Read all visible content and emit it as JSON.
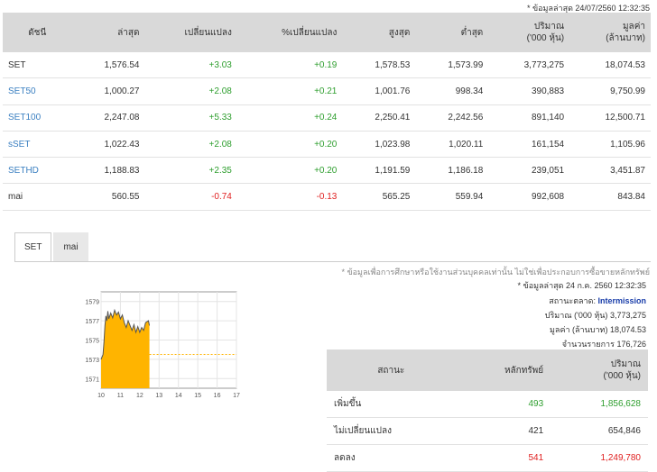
{
  "top_note": "* ข้อมูลล่าสุด 24/07/2560 12:32:35",
  "index_table": {
    "headers": [
      "ดัชนี",
      "ล่าสุด",
      "เปลี่ยนแปลง",
      "%เปลี่ยนแปลง",
      "สูงสุด",
      "ต่ำสุด",
      "ปริมาณ\n('000 หุ้น)",
      "มูลค่า\n(ล้านบาท)"
    ],
    "rows": [
      {
        "name": "SET",
        "last": "1,576.54",
        "change": "+3.03",
        "pct": "+0.19",
        "high": "1,578.53",
        "low": "1,573.99",
        "volume": "3,773,275",
        "value": "18,074.53",
        "link": false,
        "dir": "up"
      },
      {
        "name": "SET50",
        "last": "1,000.27",
        "change": "+2.08",
        "pct": "+0.21",
        "high": "1,001.76",
        "low": "998.34",
        "volume": "390,883",
        "value": "9,750.99",
        "link": true,
        "dir": "up"
      },
      {
        "name": "SET100",
        "last": "2,247.08",
        "change": "+5.33",
        "pct": "+0.24",
        "high": "2,250.41",
        "low": "2,242.56",
        "volume": "891,140",
        "value": "12,500.71",
        "link": true,
        "dir": "up"
      },
      {
        "name": "sSET",
        "last": "1,022.43",
        "change": "+2.08",
        "pct": "+0.20",
        "high": "1,023.98",
        "low": "1,020.11",
        "volume": "161,154",
        "value": "1,105.96",
        "link": true,
        "dir": "up"
      },
      {
        "name": "SETHD",
        "last": "1,188.83",
        "change": "+2.35",
        "pct": "+0.20",
        "high": "1,191.59",
        "low": "1,186.18",
        "volume": "239,051",
        "value": "3,451.87",
        "link": true,
        "dir": "up"
      },
      {
        "name": "mai",
        "last": "560.55",
        "change": "-0.74",
        "pct": "-0.13",
        "high": "565.25",
        "low": "559.94",
        "volume": "992,608",
        "value": "843.84",
        "link": false,
        "dir": "down"
      }
    ]
  },
  "tabs": [
    {
      "label": "SET",
      "active": true
    },
    {
      "label": "mai",
      "active": false
    }
  ],
  "disclaimer": "* ข้อมูลเพื่อการศึกษาหรือใช้งานส่วนบุคคลเท่านั้น ไม่ใช่เพื่อประกอบการซื้อขายหลักทรัพย์",
  "market_info": {
    "updated": "* ข้อมูลล่าสุด 24 ก.ค. 2560 12:32:35",
    "status_label": "สถานะตลาด:",
    "status_value": "Intermission",
    "volume_label": "ปริมาณ ('000 หุ้น)",
    "volume_value": "3,773,275",
    "value_label": "มูลค่า (ล้านบาท)",
    "value_value": "18,074.53",
    "trades_label": "จำนวนรายการ",
    "trades_value": "176,726"
  },
  "chart_data": {
    "type": "area",
    "title": "",
    "xlabel": "",
    "ylabel": "",
    "y_ticks": [
      "1579",
      "1577",
      "1575",
      "1573",
      "1571"
    ],
    "x_ticks": [
      "10",
      "11",
      "12",
      "13",
      "14",
      "15",
      "16",
      "17"
    ],
    "xlim": [
      10,
      17
    ],
    "ylim": [
      1570,
      1580
    ],
    "prior_close": 1573.51,
    "x": [
      10.0,
      10.1,
      10.15,
      10.2,
      10.25,
      10.3,
      10.35,
      10.4,
      10.5,
      10.6,
      10.7,
      10.8,
      10.9,
      11.0,
      11.1,
      11.2,
      11.3,
      11.4,
      11.5,
      11.6,
      11.7,
      11.8,
      11.9,
      12.0,
      12.1,
      12.2,
      12.3,
      12.45,
      12.5
    ],
    "values": [
      1573.0,
      1573.5,
      1574.8,
      1576.5,
      1577.5,
      1577.0,
      1578.0,
      1577.2,
      1577.8,
      1577.3,
      1578.1,
      1577.6,
      1577.9,
      1577.2,
      1577.6,
      1576.8,
      1576.3,
      1577.0,
      1576.5,
      1576.0,
      1576.6,
      1575.8,
      1576.4,
      1575.8,
      1576.3,
      1576.0,
      1576.8,
      1577.0,
      1576.5
    ],
    "area_color": "#ffb400",
    "line_color": "#555555",
    "ref_color": "#ffb400"
  },
  "stat_table": {
    "headers": [
      "สถานะ",
      "หลักทรัพย์",
      "ปริมาณ\n('000 หุ้น)"
    ],
    "rows": [
      {
        "label": "เพิ่มขึ้น",
        "count": "493",
        "volume": "1,856,628",
        "dir": "up"
      },
      {
        "label": "ไม่เปลี่ยนแปลง",
        "count": "421",
        "volume": "654,846",
        "dir": "same"
      },
      {
        "label": "ลดลง",
        "count": "541",
        "volume": "1,249,780",
        "dir": "down"
      }
    ]
  },
  "colors": {
    "up": "#2e9e2e",
    "down": "#e02020",
    "link": "#3a7fc1",
    "status": "#1a3eaa"
  }
}
